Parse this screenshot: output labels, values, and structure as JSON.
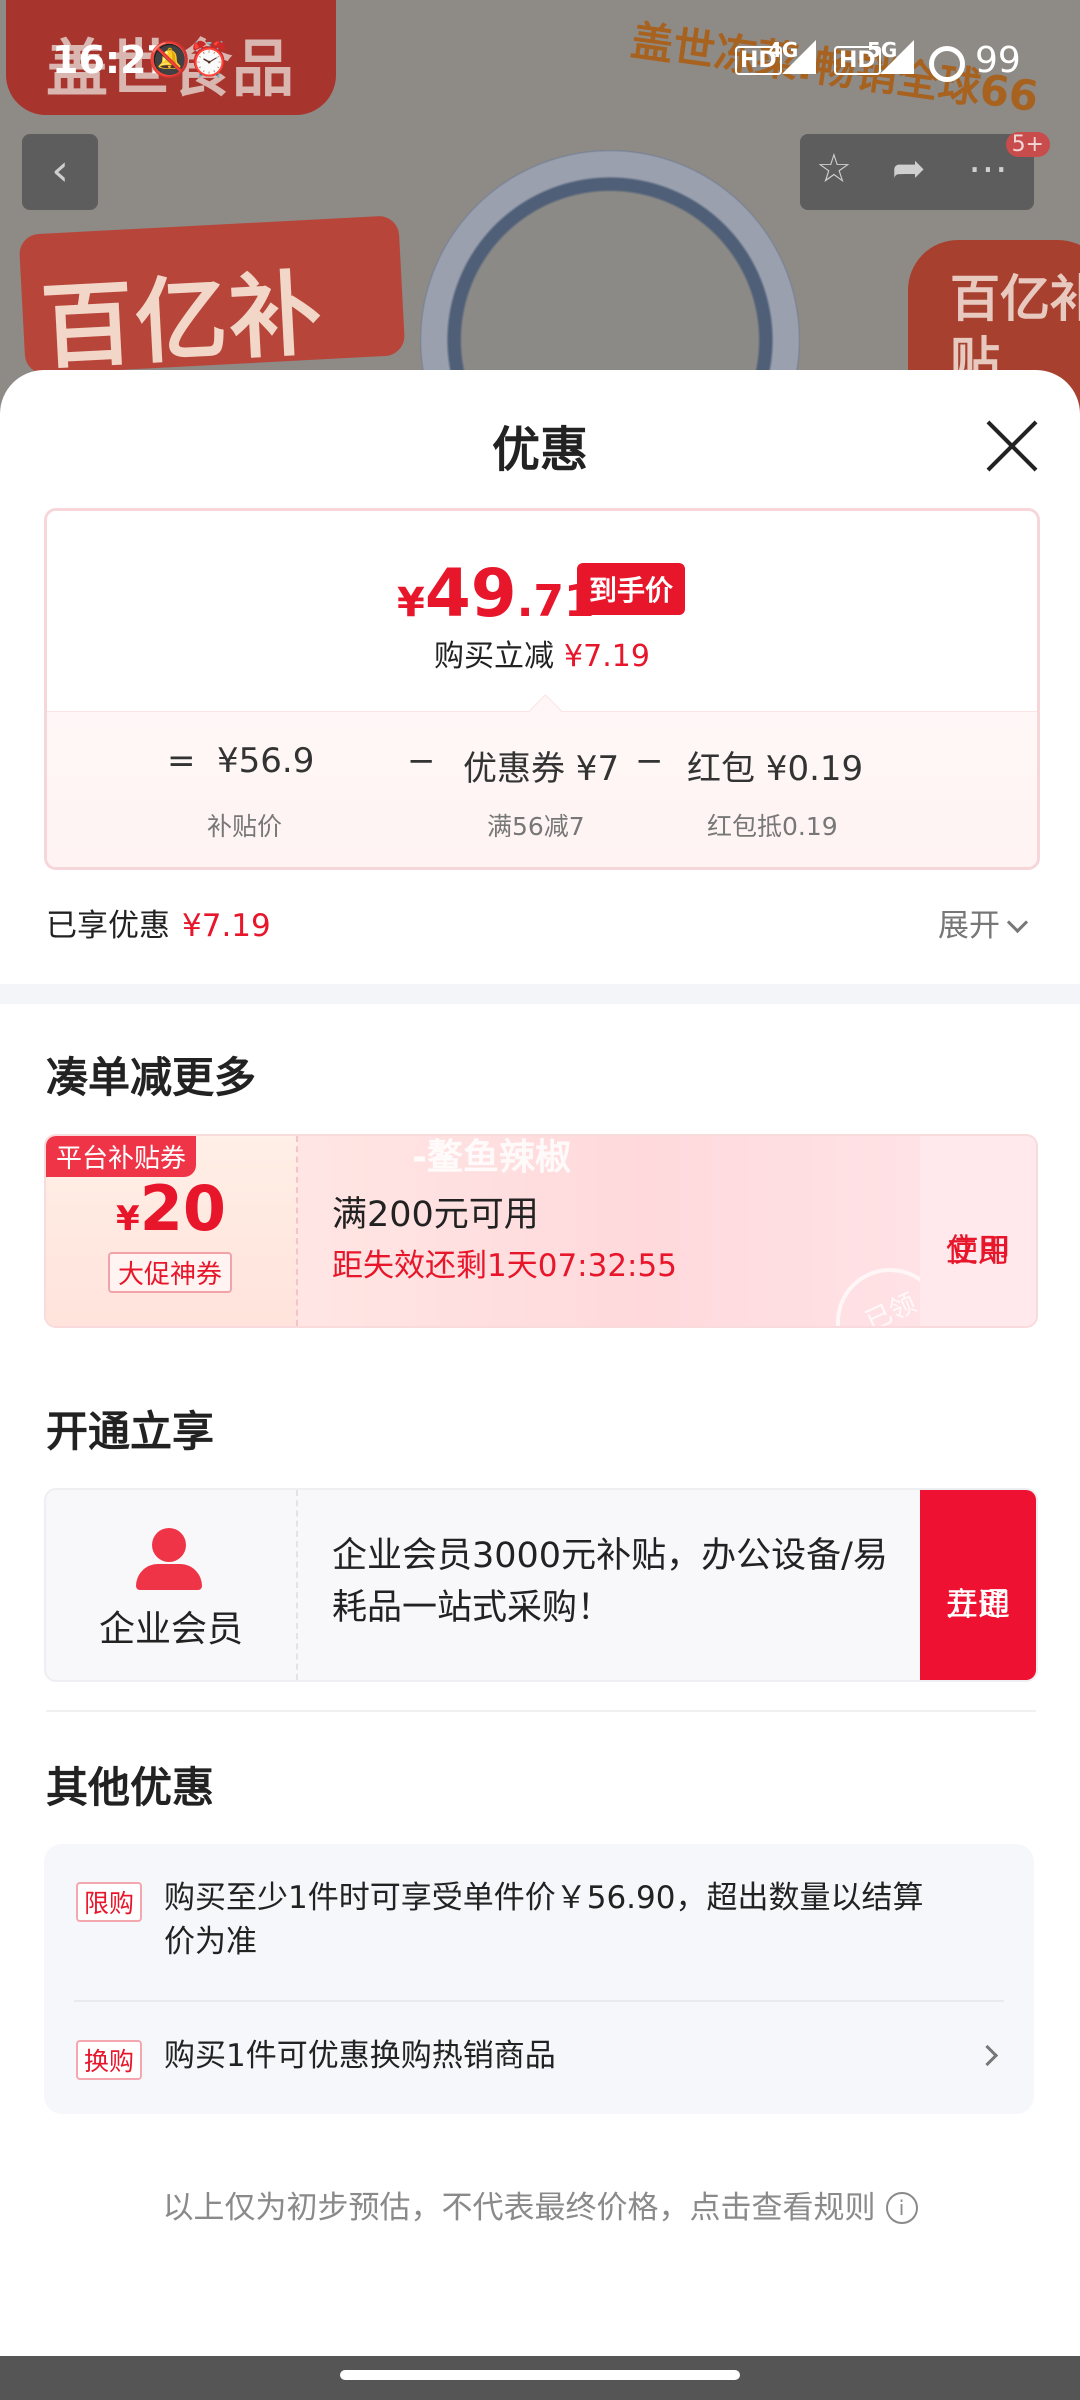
{
  "background": {
    "brand": "盖世食品",
    "slogan": "盖世冻菜.畅销全球66",
    "badge": "百亿补贴",
    "corner_badge": "百亿补贴",
    "back_icon": "chevron-left-icon",
    "tools": [
      "star-icon",
      "share-icon",
      "more-icon"
    ],
    "notification_count": "5+"
  },
  "status_bar": {
    "time": "16:27",
    "icons": [
      "mute-icon",
      "alarm-icon"
    ],
    "net1": "HD",
    "net1_type": "4G",
    "net2": "HD",
    "net2_type": "5G",
    "battery": "99"
  },
  "sheet": {
    "title": "优惠",
    "close_icon": "close-icon"
  },
  "price_card": {
    "currency": "¥",
    "price_int": "49",
    "price_dec": ".71",
    "price_tag": "到手价",
    "reduce_label": "购买立减",
    "reduce_value": "¥7.19",
    "formula": {
      "equals": "=",
      "base_value": "¥56.9",
      "base_label": "补贴价",
      "minus1": "−",
      "coupon_value": "优惠券 ¥7",
      "coupon_label": "满56减7",
      "minus2": "−",
      "redpack_value": "红包 ¥0.19",
      "redpack_label": "红包抵0.19"
    }
  },
  "enjoyed": {
    "label": "已享优惠",
    "value": "¥7.19",
    "expand": "展开"
  },
  "bundle": {
    "title": "凑单减更多",
    "coupon": {
      "ribbon": "平台补贴券",
      "currency": "¥",
      "amount": "20",
      "tag": "大促神券",
      "watermark": "-鳌鱼辣椒",
      "condition": "满200元可用",
      "expiry": "距失效还剩1天07:32:55",
      "stamp": "已领",
      "button_line1": "立即",
      "button_line2": "使用"
    }
  },
  "membership": {
    "title": "开通立享",
    "name": "企业会员",
    "description": "企业会员3000元补贴，办公设备/易耗品一站式采购！",
    "button_line1": "立即",
    "button_line2": "开通"
  },
  "other": {
    "title": "其他优惠",
    "items": [
      {
        "tag": "限购",
        "text": "购买至少1件时可享受单件价￥56.90，超出数量以结算价为准"
      },
      {
        "tag": "换购",
        "text": "购买1件可优惠换购热销商品"
      }
    ]
  },
  "disclaimer": "以上仅为初步预估，不代表最终价格，点击查看规则",
  "colors": {
    "accent": "#e8162b",
    "member_button": "#ef1131"
  }
}
